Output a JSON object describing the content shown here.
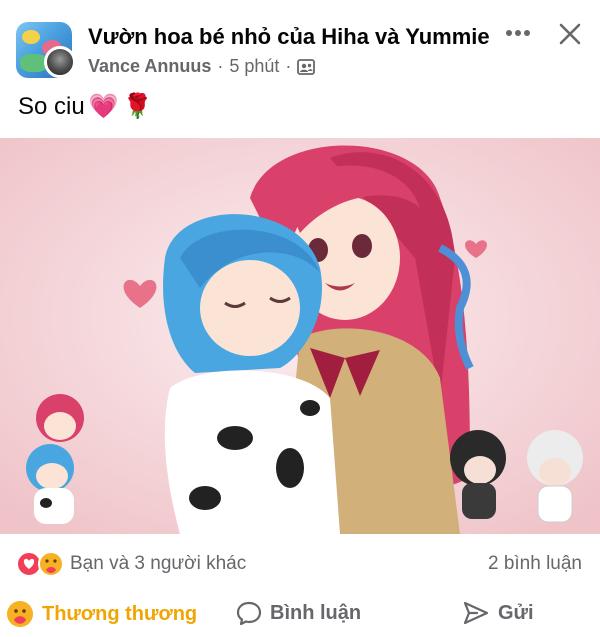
{
  "post": {
    "group_name": "Vườn hoa bé nhỏ của Hiha và Yummie",
    "author": "Vance Annuus",
    "separator": "·",
    "time": "5 phút",
    "audience_icon": "group-members-icon",
    "caption_text": "So ciu",
    "caption_emojis": [
      "💗",
      "🌹"
    ]
  },
  "header": {
    "more_icon": "more-horizontal-icon",
    "close_icon": "close-icon"
  },
  "image": {
    "description_icon": "illustration"
  },
  "reactions": {
    "icons": [
      "love-reaction-icon",
      "care-reaction-icon"
    ],
    "summary": "Bạn và 3 người khác",
    "comments": "2 bình luận"
  },
  "actions": {
    "like_label": "Thương thương",
    "comment_label": "Bình luận",
    "share_label": "Gửi"
  },
  "colors": {
    "reacted": "#f0a500",
    "muted": "#65676b",
    "love": "#f33e58",
    "care": "#f7b125"
  }
}
